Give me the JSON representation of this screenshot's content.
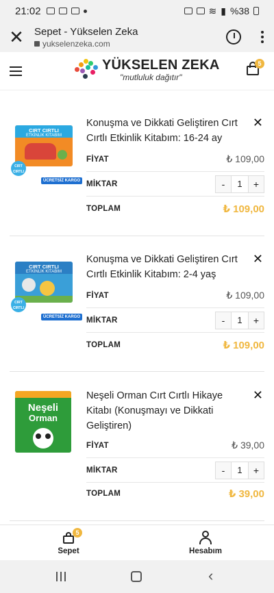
{
  "status_bar": {
    "time": "21:02",
    "battery": "%38"
  },
  "browser": {
    "title": "Sepet - Yükselen Zeka",
    "url": "yukselenzeka.com"
  },
  "site": {
    "brand": "YÜKSELEN ZEKA",
    "slogan": "\"mutluluk dağıtır\"",
    "cart_count": "5"
  },
  "labels": {
    "price": "FİYAT",
    "qty": "MİKTAR",
    "total": "TOPLAM"
  },
  "items": [
    {
      "name": "Konuşma ve Dikkati Geliştiren Cırt Cırtlı Etkinlik Kitabım: 16-24 ay",
      "price": "₺ 109,00",
      "qty": "1",
      "total": "₺ 109,00",
      "cover": {
        "title": "CIRT CIRTLI",
        "sub": "ETKİNLİK KİTABIM",
        "sticker": "CIRT CIRTLI",
        "kargo": "ÜCRETSİZ KARGO",
        "color": "#f28b25"
      }
    },
    {
      "name": "Konuşma ve Dikkati Geliştiren Cırt Cırtlı Etkinlik Kitabım: 2-4 yaş",
      "price": "₺ 109,00",
      "qty": "1",
      "total": "₺ 109,00",
      "cover": {
        "title": "CIRT CIRTLI",
        "sub": "ETKİNLİK KİTABIM",
        "sticker": "CIRT CIRTLI",
        "kargo": "ÜCRETSİZ KARGO",
        "color": "#3a9fd8"
      }
    },
    {
      "name": "Neşeli Orman Cırt Cırtlı Hikaye Kitabı (Konuşmayı ve Dikkati Geliştiren)",
      "price": "₺ 39,00",
      "qty": "1",
      "total": "₺ 39,00",
      "cover": {
        "title": "Neşeli",
        "sub": "Orman",
        "color": "#2e9c3a"
      }
    }
  ],
  "bottom_nav": {
    "cart_label": "Sepet",
    "cart_count": "5",
    "account_label": "Hesabım"
  },
  "colors": {
    "accent": "#f0b73f"
  }
}
